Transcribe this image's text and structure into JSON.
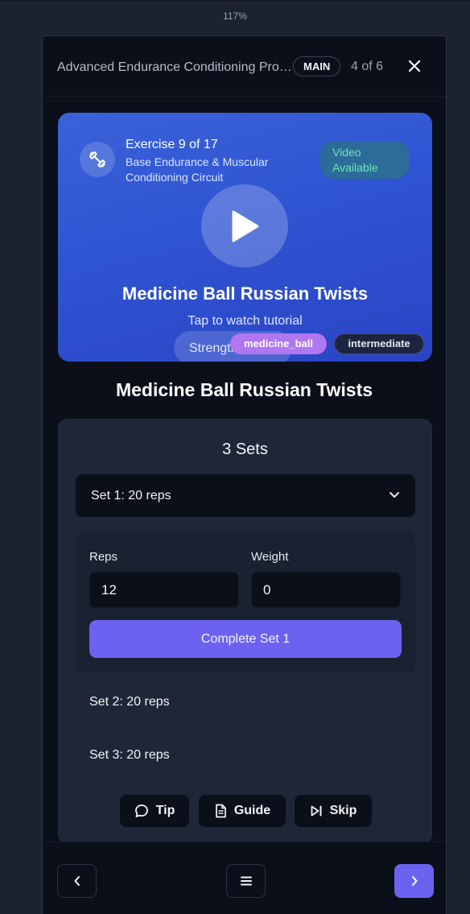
{
  "zoom": "117%",
  "header": {
    "title": "Advanced Endurance Conditioning Program",
    "badge": "MAIN",
    "count": "4 of 6"
  },
  "hero": {
    "exercise_count": "Exercise 9 of 17",
    "subtitle": "Base Endurance & Muscular Conditioning Circuit",
    "video_badge": "Video Available",
    "exercise_name": "Medicine Ball Russian Twists",
    "tap_text": "Tap to watch tutorial",
    "chips": {
      "category": "Strength",
      "equipment": "medicine_ball",
      "level": "intermediate"
    }
  },
  "exercise_title": "Medicine Ball Russian Twists",
  "sets": {
    "title": "3 Sets",
    "selected": "Set 1: 20 reps",
    "reps_label": "Reps",
    "weight_label": "Weight",
    "reps_value": "12",
    "weight_value": "0",
    "complete_label": "Complete Set 1",
    "rows": [
      "Set 2: 20 reps",
      "Set 3: 20 reps"
    ]
  },
  "actions": {
    "tip": "Tip",
    "guide": "Guide",
    "skip": "Skip"
  },
  "colors": {
    "accent": "#6b63ef",
    "hero": "#2f54d2",
    "video_badge_text": "#6ee7b7",
    "equipment_chip": "#b077f0"
  },
  "icons": {
    "close": "close-icon",
    "dumbbell": "dumbbell-icon",
    "play": "play-icon",
    "chevron": "chevron-down-icon",
    "tip": "message-bubble-icon",
    "guide": "document-icon",
    "skip": "skip-forward-icon",
    "prev": "chevron-left-icon",
    "menu": "menu-icon",
    "next": "chevron-right-icon"
  }
}
